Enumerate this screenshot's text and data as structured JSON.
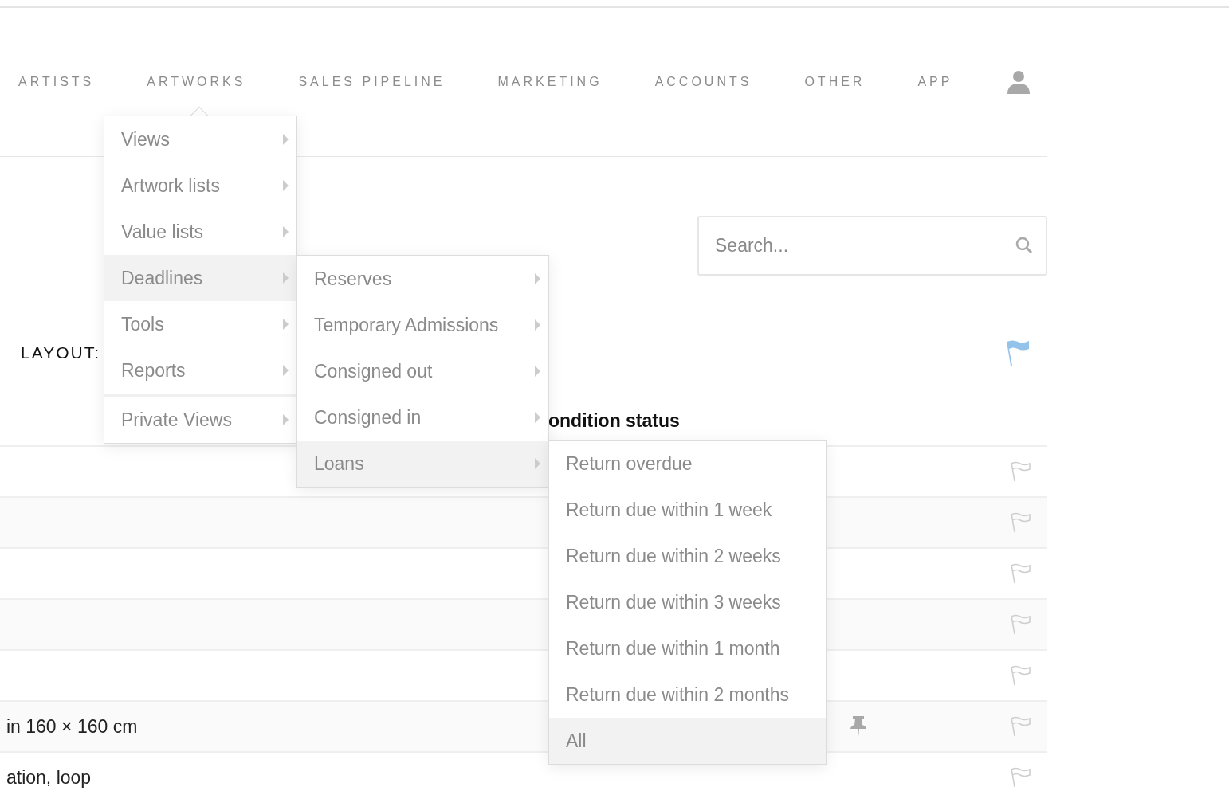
{
  "nav": {
    "items": [
      {
        "label": "ARTISTS"
      },
      {
        "label": "ARTWORKS"
      },
      {
        "label": "SALES PIPELINE"
      },
      {
        "label": "MARKETING"
      },
      {
        "label": "ACCOUNTS"
      },
      {
        "label": "OTHER"
      },
      {
        "label": "APP"
      }
    ]
  },
  "search": {
    "placeholder": "Search..."
  },
  "layout_label": "LAYOUT:",
  "table": {
    "header": "ondition status",
    "header_flagged": true,
    "rows": [
      {
        "pinned": false,
        "flagged": false
      },
      {
        "pinned": false,
        "flagged": false
      },
      {
        "pinned": false,
        "flagged": false
      },
      {
        "pinned": false,
        "flagged": false
      },
      {
        "pinned": false,
        "flagged": false
      },
      {
        "text": "in 160 × 160 cm",
        "pinned": true,
        "flagged": false
      },
      {
        "text": "ation, loop",
        "pinned": false,
        "flagged": false
      }
    ]
  },
  "menus": [
    {
      "items": [
        {
          "label": "Views",
          "selected": false,
          "submenu": true,
          "separator_before": false
        },
        {
          "label": "Artwork lists",
          "selected": false,
          "submenu": true,
          "separator_before": false
        },
        {
          "label": "Value lists",
          "selected": false,
          "submenu": true,
          "separator_before": false
        },
        {
          "label": "Deadlines",
          "selected": true,
          "submenu": true,
          "separator_before": false
        },
        {
          "label": "Tools",
          "selected": false,
          "submenu": true,
          "separator_before": false
        },
        {
          "label": "Reports",
          "selected": false,
          "submenu": true,
          "separator_before": false
        },
        {
          "label": "Private Views",
          "selected": false,
          "submenu": true,
          "separator_before": true
        }
      ]
    },
    {
      "items": [
        {
          "label": "Reserves",
          "selected": false,
          "submenu": true,
          "separator_before": false
        },
        {
          "label": "Temporary Admissions",
          "selected": false,
          "submenu": true,
          "separator_before": false
        },
        {
          "label": "Consigned out",
          "selected": false,
          "submenu": true,
          "separator_before": false
        },
        {
          "label": "Consigned in",
          "selected": false,
          "submenu": true,
          "separator_before": false
        },
        {
          "label": "Loans",
          "selected": true,
          "submenu": true,
          "separator_before": false
        }
      ]
    },
    {
      "items": [
        {
          "label": "Return overdue",
          "selected": false,
          "submenu": false,
          "separator_before": false
        },
        {
          "label": "Return due within 1 week",
          "selected": false,
          "submenu": false,
          "separator_before": false
        },
        {
          "label": "Return due within 2 weeks",
          "selected": false,
          "submenu": false,
          "separator_before": false
        },
        {
          "label": "Return due within 3 weeks",
          "selected": false,
          "submenu": false,
          "separator_before": false
        },
        {
          "label": "Return due within 1 month",
          "selected": false,
          "submenu": false,
          "separator_before": false
        },
        {
          "label": "Return due within 2 months",
          "selected": false,
          "submenu": false,
          "separator_before": false
        },
        {
          "label": "All",
          "selected": true,
          "submenu": false,
          "separator_before": false
        }
      ]
    }
  ]
}
